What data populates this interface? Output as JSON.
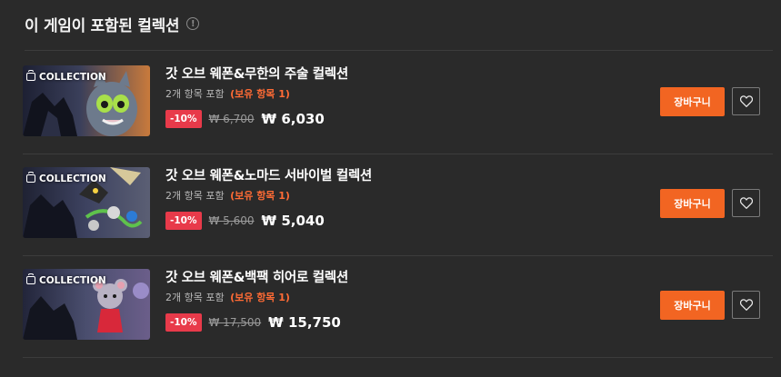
{
  "section": {
    "title": "이 게임이 포함된 컬렉션",
    "info_icon": "info-circle-icon"
  },
  "items": [
    {
      "badge": "COLLECTION",
      "name": "갓 오브 웨폰&무한의 주술 컬렉션",
      "count_text": "2개 항목 포함",
      "owned_text": "(보유 항목 1)",
      "discount": "-10%",
      "original_price": "₩ 6,700",
      "final_price": "₩ 6,030",
      "cart_label": "장바구니",
      "wish_icon": "heart-icon"
    },
    {
      "badge": "COLLECTION",
      "name": "갓 오브 웨폰&노마드 서바이벌 컬렉션",
      "count_text": "2개 항목 포함",
      "owned_text": "(보유 항목 1)",
      "discount": "-10%",
      "original_price": "₩ 5,600",
      "final_price": "₩ 5,040",
      "cart_label": "장바구니",
      "wish_icon": "heart-icon"
    },
    {
      "badge": "COLLECTION",
      "name": "갓 오브 웨폰&백팩 히어로 컬렉션",
      "count_text": "2개 항목 포함",
      "owned_text": "(보유 항목 1)",
      "discount": "-10%",
      "original_price": "₩ 17,500",
      "final_price": "₩ 15,750",
      "cart_label": "장바구니",
      "wish_icon": "heart-icon"
    }
  ],
  "colors": {
    "background": "#2a2a2a",
    "accent_orange": "#f26522",
    "discount_red": "#e83a4a",
    "owned_orange": "#ff6b35"
  }
}
